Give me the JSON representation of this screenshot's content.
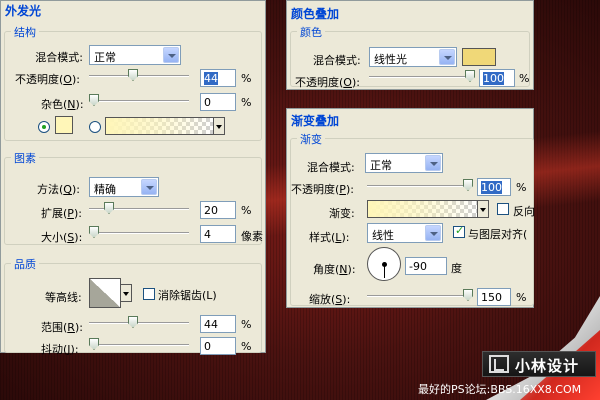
{
  "colors": {
    "accent": "#0046d5",
    "panel_bg": "#ece9d8",
    "highlight_bg": "#316ac5",
    "outer_glow_color": "#fff6b8",
    "color_overlay_color": "#f0d878"
  },
  "outer_glow": {
    "title": "外发光",
    "structure": {
      "title": "结构",
      "blend_mode_label": "混合模式:",
      "blend_mode_value": "正常",
      "opacity_label": "不透明度(",
      "opacity_key": "O",
      "opacity_close": "):",
      "opacity_value": "44",
      "opacity_fraction": 0.44,
      "noise_label": "杂色(",
      "noise_key": "N",
      "noise_close": "):",
      "noise_value": "0",
      "noise_fraction": 0.0,
      "unit": "%"
    },
    "elements": {
      "title": "图素",
      "method_label": "方法(",
      "method_key": "Q",
      "method_close": "):",
      "method_value": "精确",
      "spread_label": "扩展(",
      "spread_key": "P",
      "spread_close": "):",
      "spread_value": "20",
      "spread_fraction": 0.2,
      "spread_unit": "%",
      "size_label": "大小(",
      "size_key": "S",
      "size_close": "):",
      "size_value": "4",
      "size_fraction": 0.02,
      "size_unit": "像素"
    },
    "quality": {
      "title": "品质",
      "contour_label": "等高线:",
      "anti_alias_label": "消除锯齿(L)",
      "range_label": "范围(",
      "range_key": "R",
      "range_close": "):",
      "range_value": "44",
      "range_fraction": 0.44,
      "jitter_label": "抖动(",
      "jitter_key": "J",
      "jitter_close": "):",
      "jitter_value": "0",
      "jitter_fraction": 0.0,
      "unit": "%"
    }
  },
  "color_overlay": {
    "title": "颜色叠加",
    "group_title": "颜色",
    "blend_mode_label": "混合模式:",
    "blend_mode_value": "线性光",
    "opacity_label": "不透明度(",
    "opacity_key": "O",
    "opacity_close": "):",
    "opacity_value": "100",
    "opacity_fraction": 1.0,
    "unit": "%"
  },
  "gradient_overlay": {
    "title": "渐变叠加",
    "group_title": "渐变",
    "blend_mode_label": "混合模式:",
    "blend_mode_value": "正常",
    "opacity_label": "不透明度(",
    "opacity_key": "P",
    "opacity_close": "):",
    "opacity_value": "100",
    "opacity_fraction": 1.0,
    "gradient_label": "渐变:",
    "reverse_label": "反向",
    "style_label": "样式(",
    "style_key": "L",
    "style_close": "):",
    "style_value": "线性",
    "align_label": "与图层对齐(",
    "angle_label": "角度(",
    "angle_key": "N",
    "angle_close": "):",
    "angle_value": "-90",
    "angle_unit": "度",
    "scale_label": "缩放(",
    "scale_key": "S",
    "scale_close": "):",
    "scale_value": "150",
    "scale_fraction": 1.0,
    "unit": "%"
  },
  "branding": {
    "logo_text": "小林设计",
    "footer": "最好的PS论坛:BBS.16XX8.COM"
  }
}
